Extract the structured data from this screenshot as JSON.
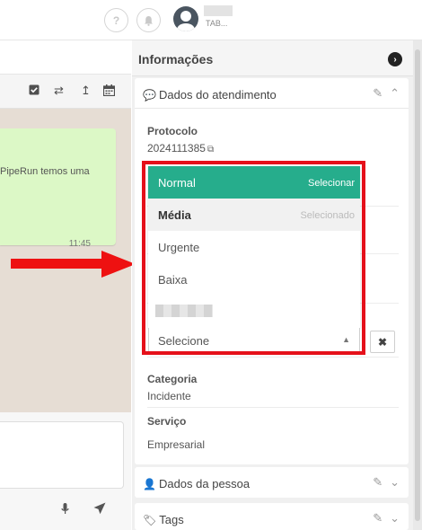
{
  "topbar": {
    "help_icon": "question-icon",
    "notifications_icon": "bell-icon",
    "user_sub": "TAB..."
  },
  "chat": {
    "toolbar_icons": [
      "check-square-icon",
      "exchange-icon",
      "level-up-icon",
      "calendar-icon"
    ],
    "message_text": "PipeRun temos uma",
    "message_time": "11:45",
    "mic_icon": "microphone-icon",
    "send_icon": "send-icon"
  },
  "info": {
    "title": "Informações",
    "collapse_icon": "chevron-right-circle-icon"
  },
  "attendance": {
    "title": "Dados do atendimento",
    "icon": "comments-icon",
    "protocol_label": "Protocolo",
    "protocol_value": "2024111385",
    "category_label": "Categoria",
    "category_value": "Incidente",
    "service_label": "Serviço",
    "service_value": "Empresarial"
  },
  "priority_dropdown": {
    "options": [
      {
        "label": "Normal",
        "hint": "Selecionar",
        "state": "highlighted"
      },
      {
        "label": "Média",
        "hint": "Selecionado",
        "state": "selected"
      },
      {
        "label": "Urgente",
        "hint": "",
        "state": "normal"
      },
      {
        "label": "Baixa",
        "hint": "",
        "state": "normal"
      }
    ],
    "current_value": "Selecione",
    "clear_label": "✖",
    "highlight_color": "#26ad8c",
    "annotation_color": "#e5101a"
  },
  "person": {
    "title": "Dados da pessoa",
    "icon": "user-icon"
  },
  "tags": {
    "title": "Tags",
    "icon": "tag-icon"
  }
}
